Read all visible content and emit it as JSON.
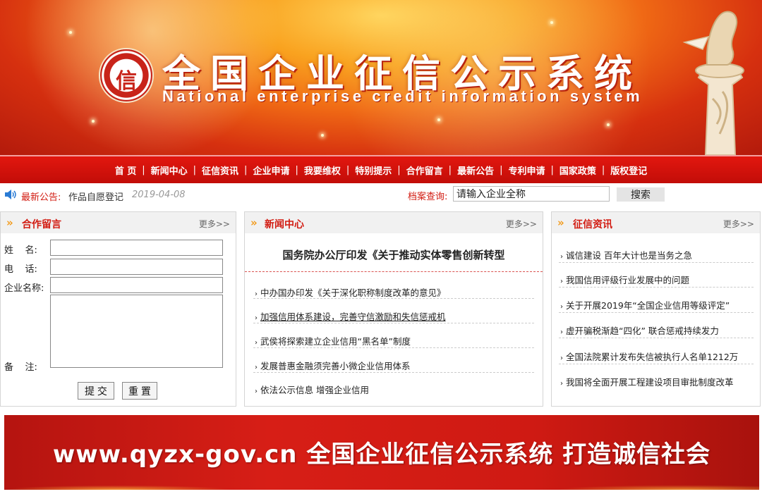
{
  "banner": {
    "seal_char": "信",
    "title": "全国企业征信公示系统",
    "subtitle": "National enterprise credit information system"
  },
  "nav": {
    "items": [
      "首 页",
      "新闻中心",
      "征信资讯",
      "企业申请",
      "我要维权",
      "特别提示",
      "合作留言",
      "最新公告",
      "专利申请",
      "国家政策",
      "版权登记"
    ],
    "separator": "|"
  },
  "notice": {
    "label": "最新公告:",
    "text": "作品自愿登记",
    "date": "2019-04-08",
    "archive_label": "档案查询:",
    "search_value": "请输入企业全称",
    "search_button": "搜索"
  },
  "message_panel": {
    "title": "合作留言",
    "more": "更多>>",
    "name_label": "姓    名:",
    "phone_label": "电    话:",
    "company_label": "企业名称:",
    "remark_label": "备    注:",
    "submit": "提 交",
    "reset": "重 置"
  },
  "news_panel": {
    "title": "新闻中心",
    "more": "更多>>",
    "headline": "国务院办公厅印发《关于推动实体零售创新转型",
    "items": [
      "中办国办印发《关于深化职称制度改革的意见》",
      "加强信用体系建设，完善守信激励和失信惩戒机",
      "武侯将探索建立企业信用“黑名单”制度",
      "发展普惠金融须完善小微企业信用体系",
      "依法公示信息 增强企业信用"
    ]
  },
  "credit_panel": {
    "title": "征信资讯",
    "more": "更多>>",
    "items": [
      "诚信建设 百年大计也是当务之急",
      "我国信用评级行业发展中的问题",
      "关于开展2019年“全国企业信用等级评定”",
      "虚开骗税渐趋“四化” 联合惩戒持续发力",
      "全国法院累计发布失信被执行人名单1212万",
      "我国将全面开展工程建设项目审批制度改革"
    ]
  },
  "bottom_banner": {
    "slogan": "www.qyzx-gov.cn 全国企业征信公示系统 打造诚信社会"
  },
  "colors": {
    "brand_red": "#d21b11",
    "nav_red": "#e2170f",
    "accent_orange": "#f29b1b"
  }
}
